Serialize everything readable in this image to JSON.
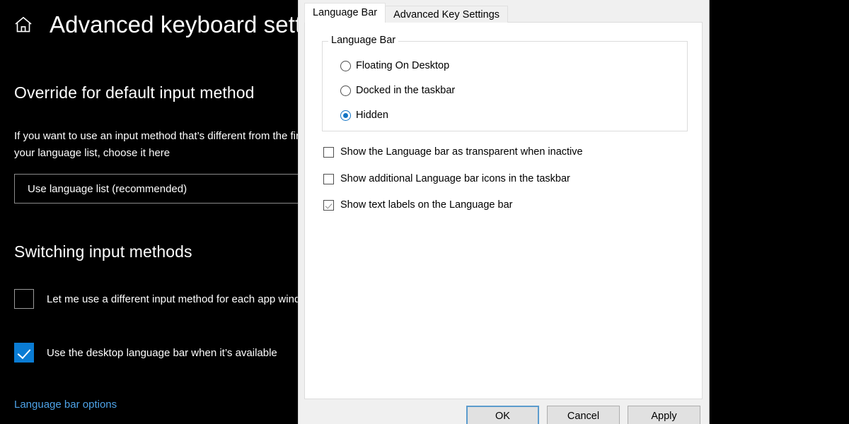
{
  "settings": {
    "home_icon": "home-icon",
    "title": "Advanced keyboard settings",
    "override_heading": "Override for default input method",
    "override_description_line1": "If you want to use an input method that’s different from the first one in",
    "override_description_line2": "your language list, choose it here",
    "override_combo_value": "Use language list (recommended)",
    "switching_heading": "Switching input methods",
    "checkbox_different_method": {
      "label": "Let me use a different input method for each app window",
      "checked": false
    },
    "checkbox_desktop_language_bar": {
      "label": "Use the desktop language bar when it’s available",
      "checked": true
    },
    "language_bar_options_link": "Language bar options",
    "accent_color": "#0a7cd4",
    "link_color": "#4ea3e8",
    "background_color": "#000000"
  },
  "dialog": {
    "tabs": [
      {
        "label": "Language Bar",
        "active": true
      },
      {
        "label": "Advanced Key Settings",
        "active": false
      }
    ],
    "groupbox": {
      "label": "Language Bar",
      "radios": [
        {
          "label": "Floating On Desktop",
          "selected": false
        },
        {
          "label": "Docked in the taskbar",
          "selected": false
        },
        {
          "label": "Hidden",
          "selected": true
        }
      ]
    },
    "checkboxes": [
      {
        "label": "Show the Language bar as transparent when inactive",
        "checked": false
      },
      {
        "label": "Show additional Language bar icons in the taskbar",
        "checked": false
      },
      {
        "label": "Show text labels on the Language bar",
        "checked": true
      }
    ],
    "buttons": [
      {
        "label": "OK",
        "default": true
      },
      {
        "label": "Cancel",
        "default": false
      },
      {
        "label": "Apply",
        "default": false
      }
    ],
    "accent_color": "#1173c4",
    "focus_border_color": "#5c9ccd",
    "surface_color": "#f0f0f0"
  }
}
